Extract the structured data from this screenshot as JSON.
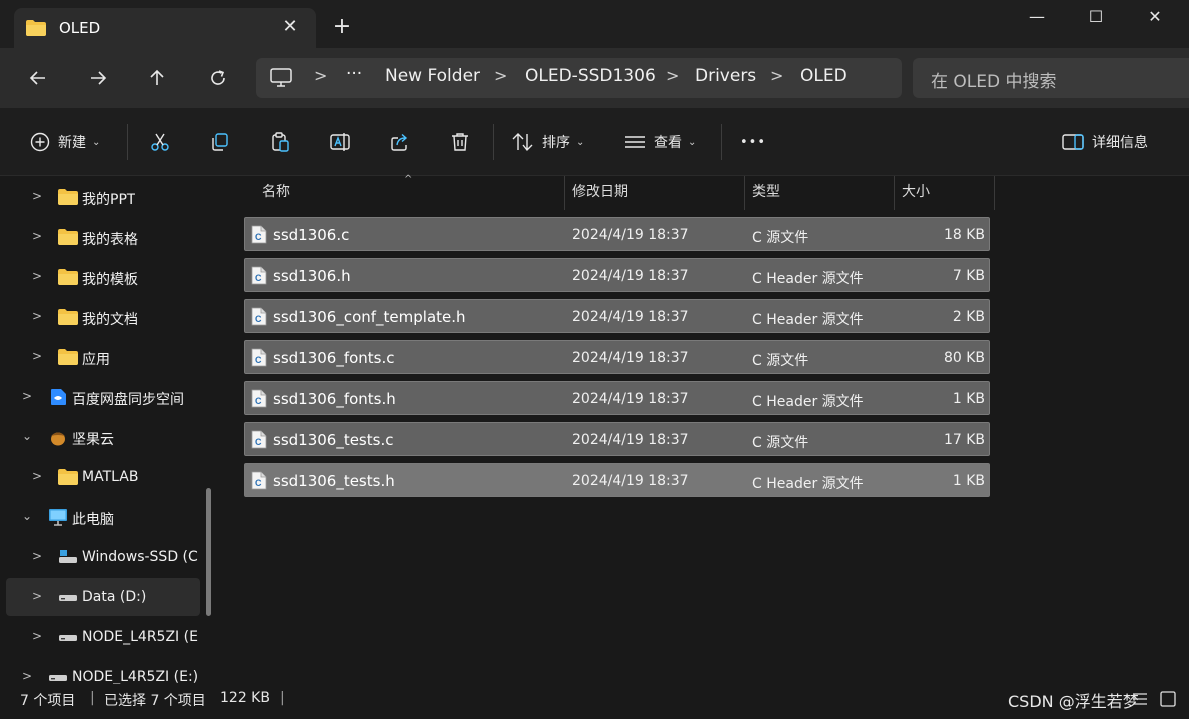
{
  "window": {
    "tab_title": "OLED",
    "new_tab": "+",
    "minimize": "—",
    "maximize": "☐",
    "close": "✕"
  },
  "nav": {
    "breadcrumb": [
      "New Folder",
      "OLED-SSD1306",
      "Drivers",
      "OLED"
    ],
    "ellipsis": "···",
    "search_placeholder": "在 OLED 中搜索"
  },
  "toolbar": {
    "new_label": "新建",
    "sort_label": "排序",
    "view_label": "查看",
    "more_label": "•••",
    "details_label": "详细信息"
  },
  "sidebar": {
    "items": [
      {
        "label": "我的PPT",
        "icon": "folder-icon"
      },
      {
        "label": "我的表格",
        "icon": "folder-icon"
      },
      {
        "label": "我的模板",
        "icon": "folder-icon"
      },
      {
        "label": "我的文档",
        "icon": "folder-icon"
      },
      {
        "label": "应用",
        "icon": "folder-icon"
      },
      {
        "label": "百度网盘同步空间",
        "icon": "baidu-netdisk-icon"
      },
      {
        "label": "坚果云",
        "icon": "nutstore-icon"
      },
      {
        "label": "MATLAB",
        "icon": "folder-icon"
      },
      {
        "label": "此电脑",
        "icon": "computer-icon"
      },
      {
        "label": "Windows-SSD (C",
        "icon": "system-drive-icon"
      },
      {
        "label": "Data (D:)",
        "icon": "drive-icon"
      },
      {
        "label": "NODE_L4R5ZI (E",
        "icon": "drive-icon"
      },
      {
        "label": "NODE_L4R5ZI (E:)",
        "icon": "drive-icon"
      }
    ]
  },
  "columns": {
    "name": "名称",
    "date": "修改日期",
    "type": "类型",
    "size": "大小"
  },
  "files": [
    {
      "name": "ssd1306.c",
      "date": "2024/4/19 18:37",
      "type": "C 源文件",
      "size": "18 KB"
    },
    {
      "name": "ssd1306.h",
      "date": "2024/4/19 18:37",
      "type": "C Header 源文件",
      "size": "7 KB"
    },
    {
      "name": "ssd1306_conf_template.h",
      "date": "2024/4/19 18:37",
      "type": "C Header 源文件",
      "size": "2 KB"
    },
    {
      "name": "ssd1306_fonts.c",
      "date": "2024/4/19 18:37",
      "type": "C 源文件",
      "size": "80 KB"
    },
    {
      "name": "ssd1306_fonts.h",
      "date": "2024/4/19 18:37",
      "type": "C Header 源文件",
      "size": "1 KB"
    },
    {
      "name": "ssd1306_tests.c",
      "date": "2024/4/19 18:37",
      "type": "C 源文件",
      "size": "17 KB"
    },
    {
      "name": "ssd1306_tests.h",
      "date": "2024/4/19 18:37",
      "type": "C Header 源文件",
      "size": "1 KB"
    }
  ],
  "status": {
    "item_count": "7 个项目",
    "selected": "已选择 7 个项目",
    "selected_size": "122 KB",
    "watermark": "CSDN @浮生若梦"
  },
  "colors": {
    "folder": "#f3c244",
    "accent": "#4cc2ff",
    "row_selected": "#626262"
  }
}
